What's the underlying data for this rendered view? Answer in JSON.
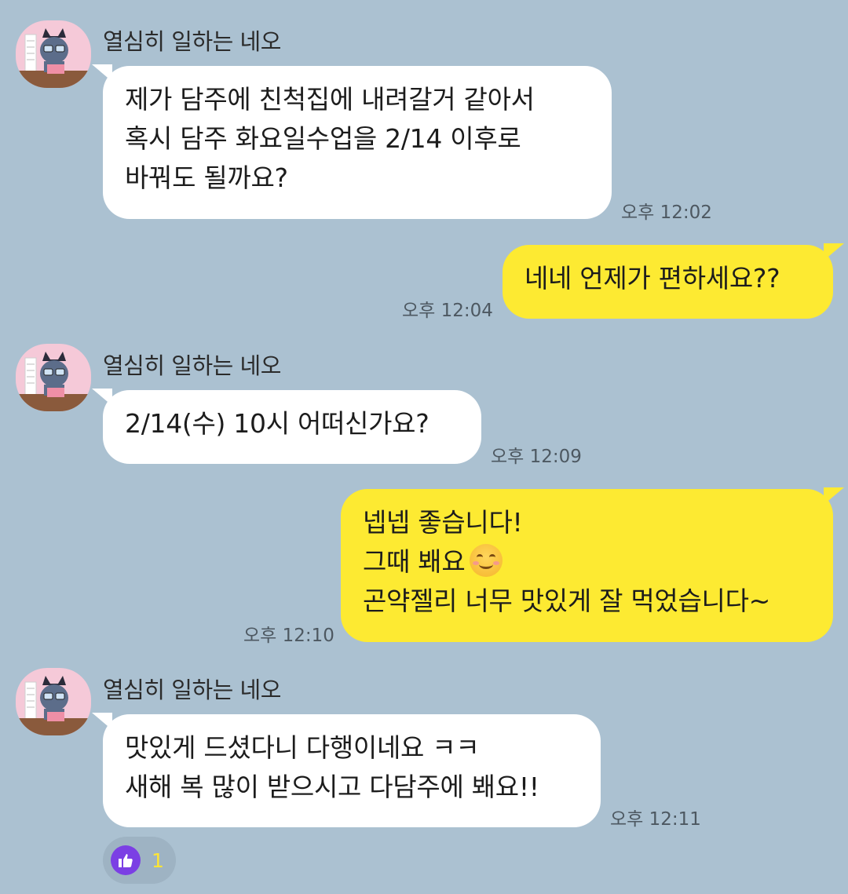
{
  "sender_name": "열심히 일하는 네오",
  "messages": [
    {
      "dir": "in",
      "lines": [
        "제가 담주에 친척집에 내려갈거 같아서",
        "혹시 담주 화요일수업을 2/14 이후로",
        "바꿔도 될까요?"
      ],
      "time": "오후 12:02"
    },
    {
      "dir": "out",
      "lines": [
        "네네 언제가 편하세요??"
      ],
      "time": "오후 12:04"
    },
    {
      "dir": "in",
      "lines": [
        "2/14(수) 10시 어떠신가요?"
      ],
      "time": "오후 12:09"
    },
    {
      "dir": "out",
      "lines": [
        "넵넵 좋습니다!",
        "그때 봬요",
        "곤약젤리 너무 맛있게 잘 먹었습니다~"
      ],
      "time": "오후 12:10",
      "emoji": "smiling-face-emoji"
    },
    {
      "dir": "in",
      "lines": [
        "맛있게 드셨다니 다행이네요 ㅋㅋ",
        "새해 복 많이 받으시고 다담주에 봬요!!"
      ],
      "time": "오후 12:11"
    }
  ],
  "reaction": {
    "icon": "thumbs-up-icon",
    "count": "1"
  },
  "colors": {
    "background": "#abc1d1",
    "incoming_bubble": "#ffffff",
    "outgoing_bubble": "#fdea32",
    "avatar_bg": "#f5c9d8",
    "reaction_icon": "#7b3fe4"
  }
}
